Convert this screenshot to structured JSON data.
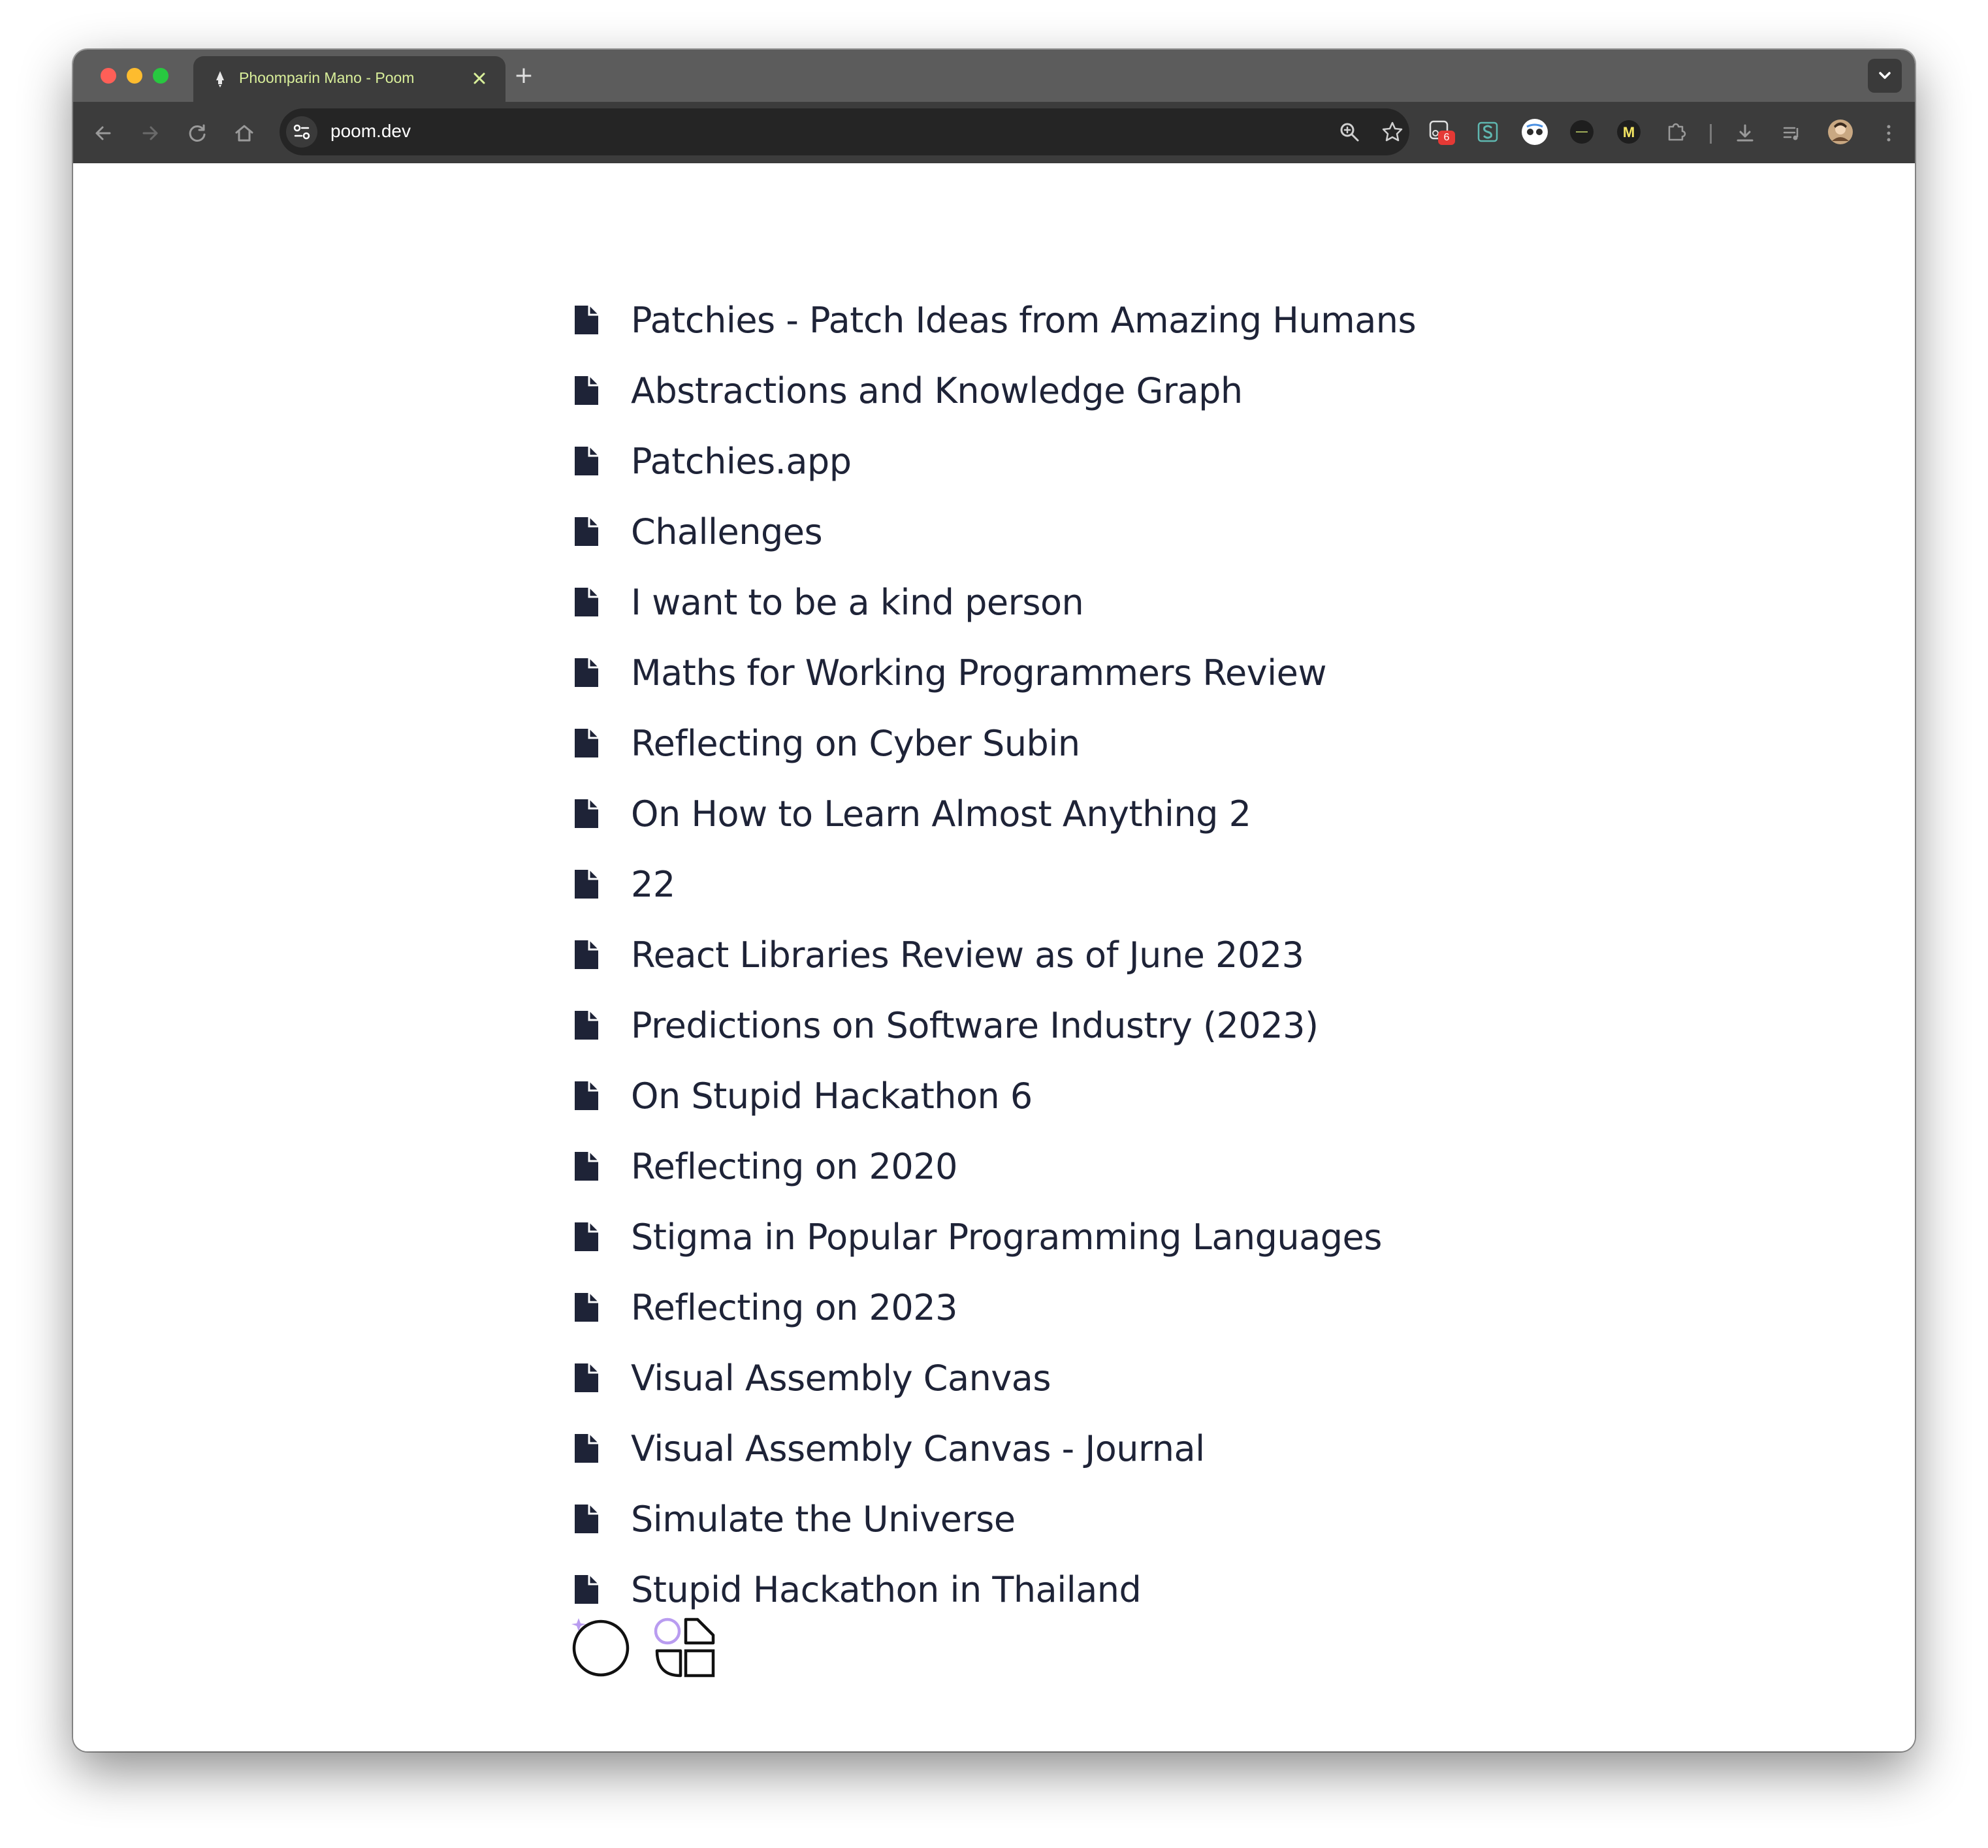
{
  "browser": {
    "tab": {
      "title": "Phoomparin Mano - Poom",
      "favicon": "rocket-icon"
    },
    "new_tab_label": "+",
    "address": {
      "url": "poom.dev"
    },
    "extensions": [
      {
        "name": "adblock-extension-icon",
        "badge": "6"
      },
      {
        "name": "s-extension-icon"
      },
      {
        "name": "mascot-extension-icon"
      },
      {
        "name": "dark-extension-icon"
      },
      {
        "name": "m-extension-icon",
        "label": "M"
      },
      {
        "name": "puzzle-icon"
      }
    ]
  },
  "posts": [
    "Patchies - Patch Ideas from Amazing Humans",
    "Abstractions and Knowledge Graph",
    "Patchies.app",
    "Challenges",
    "I want to be a kind person",
    "Maths for Working Programmers Review",
    "Reflecting on Cyber Subin",
    "On How to Learn Almost Anything 2",
    "22",
    "React Libraries Review as of June 2023",
    "Predictions on Software Industry (2023)",
    "On Stupid Hackathon 6",
    "Reflecting on 2020",
    "Stigma in Popular Programming Languages",
    "Reflecting on 2023",
    "Visual Assembly Canvas",
    "Visual Assembly Canvas - Journal",
    "Simulate the Universe",
    "Stupid Hackathon in Thailand"
  ],
  "footer": {
    "icons": [
      "circle-sparkle-logo-icon",
      "shapes-grid-logo-icon"
    ]
  },
  "colors": {
    "text": "#1e2337",
    "accent": "#b99cf0",
    "tab_text": "#d9ef9a"
  }
}
